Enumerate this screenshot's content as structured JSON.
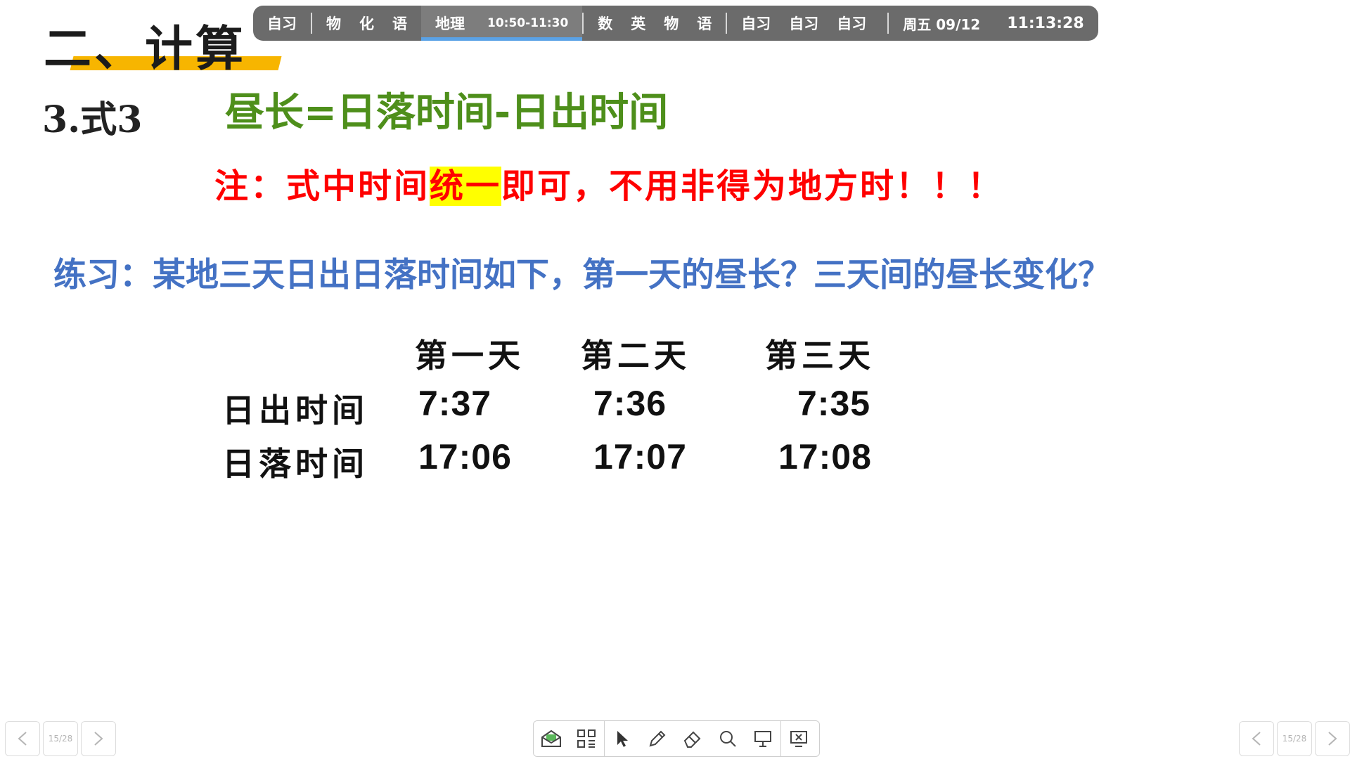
{
  "slide": {
    "title": "二、计算",
    "formula_label": "3.式3",
    "formula": "昼长=日落时间-日出时间",
    "note_before": "注：式中时间",
    "note_highlight": "统一",
    "note_after": "即可，不用非得为地方时！！！",
    "exercise": "练习：某地三天日出日落时间如下，第一天的昼长？三天间的昼长变化？",
    "table": {
      "day_headers": [
        "第一天",
        "第二天",
        "第三天"
      ],
      "rows": [
        {
          "label": "日出时间",
          "values": [
            "7:37",
            "7:36",
            "7:35"
          ]
        },
        {
          "label": "日落时间",
          "values": [
            "17:06",
            "17:07",
            "17:08"
          ]
        }
      ]
    }
  },
  "schedule_bar": {
    "group1": [
      "自习"
    ],
    "group2": [
      "物",
      "化",
      "语"
    ],
    "active": {
      "subject": "地理",
      "time": "10:50-11:30"
    },
    "group3": [
      "数",
      "英",
      "物",
      "语"
    ],
    "group4": [
      "自习",
      "自习",
      "自习"
    ],
    "weekday_date": "周五 09/12",
    "clock": "11:13:28",
    "accent_color": "#5aa2e6"
  },
  "pager": {
    "left_label": "15/28",
    "right_label": "15/28"
  },
  "toolbar_icons": [
    "whiteboard-icon",
    "grid-icon",
    "cursor-icon",
    "pen-icon",
    "eraser-icon",
    "search-icon",
    "screen-icon",
    "exit-icon"
  ],
  "colors": {
    "formula": "#4e8f1b",
    "note": "#ff0000",
    "highlight": "#ffff00",
    "exercise": "#4472c4",
    "title_underline": "#f7b500"
  }
}
